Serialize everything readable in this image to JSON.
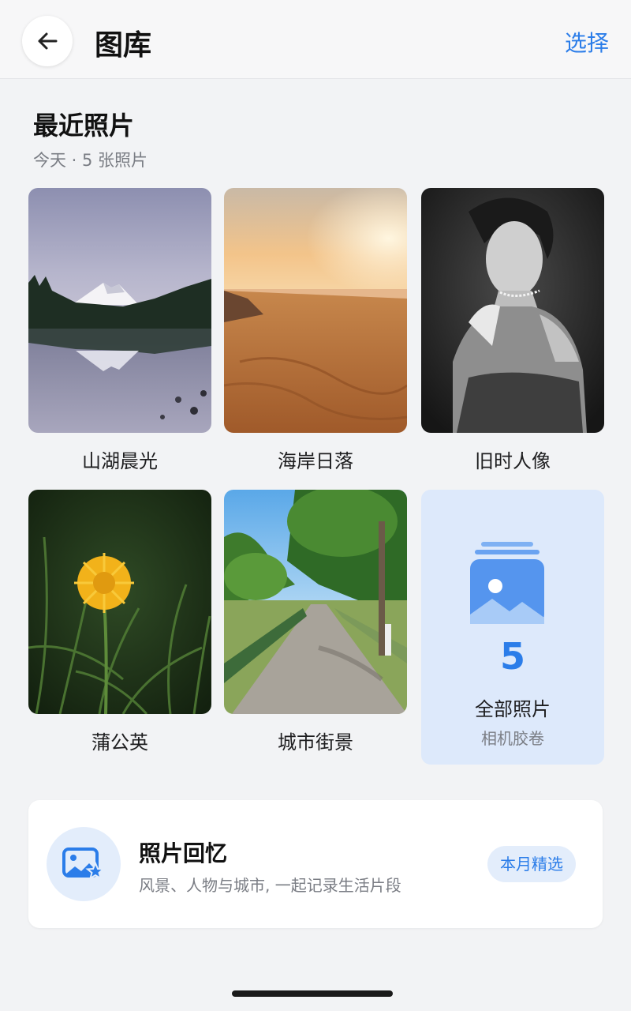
{
  "header": {
    "title": "图库",
    "select_label": "选择"
  },
  "section": {
    "title": "最近照片",
    "subtitle": "今天 · 5 张照片"
  },
  "photos": [
    {
      "label": "山湖晨光",
      "icon": "mountain-lake-photo"
    },
    {
      "label": "海岸日落",
      "icon": "beach-sunset-photo"
    },
    {
      "label": "旧时人像",
      "icon": "vintage-portrait-photo"
    },
    {
      "label": "蒲公英",
      "icon": "dandelion-photo"
    },
    {
      "label": "城市街景",
      "icon": "street-scene-photo"
    }
  ],
  "all_photos": {
    "count": "5",
    "label": "全部照片",
    "sub": "相机胶卷",
    "icon": "photo-stack-icon"
  },
  "memories": {
    "title": "照片回忆",
    "subtitle": "风景、人物与城市, 一起记录生活片段",
    "badge": "本月精选",
    "icon": "photo-star-icon"
  },
  "colors": {
    "accent": "#2b7de9",
    "background": "#f2f3f5",
    "card_tint": "#dde9fb"
  }
}
